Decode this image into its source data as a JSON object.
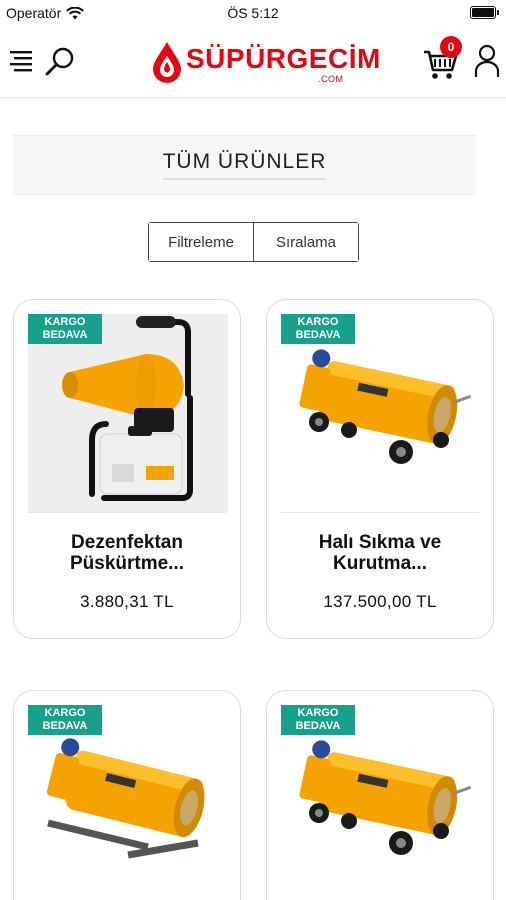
{
  "status_bar": {
    "carrier": "Operatör",
    "time": "ÖS 5:12"
  },
  "header": {
    "logo_text": "SÜPÜRGECİM",
    "logo_sub": ".COM",
    "cart_count": "0",
    "icons": [
      "menu-icon",
      "search-icon",
      "cart-icon",
      "user-icon"
    ]
  },
  "page": {
    "title": "TÜM ÜRÜNLER"
  },
  "controls": {
    "filter_label": "Filtreleme",
    "sort_label": "Sıralama"
  },
  "colors": {
    "brand_red": "#e30613",
    "badge_green": "#17a08c",
    "product_yellow": "#f5a300"
  },
  "products": [
    {
      "badge": "KARGO\nBEDAVA",
      "title": "Dezenfektan Püskürtme...",
      "price": "3.880,31 TL"
    },
    {
      "badge": "KARGO\nBEDAVA",
      "title": "Halı Sıkma ve Kurutma...",
      "price": "137.500,00 TL"
    },
    {
      "badge": "KARGO\nBEDAVA",
      "title": "",
      "price": ""
    },
    {
      "badge": "KARGO\nBEDAVA",
      "title": "",
      "price": ""
    }
  ]
}
